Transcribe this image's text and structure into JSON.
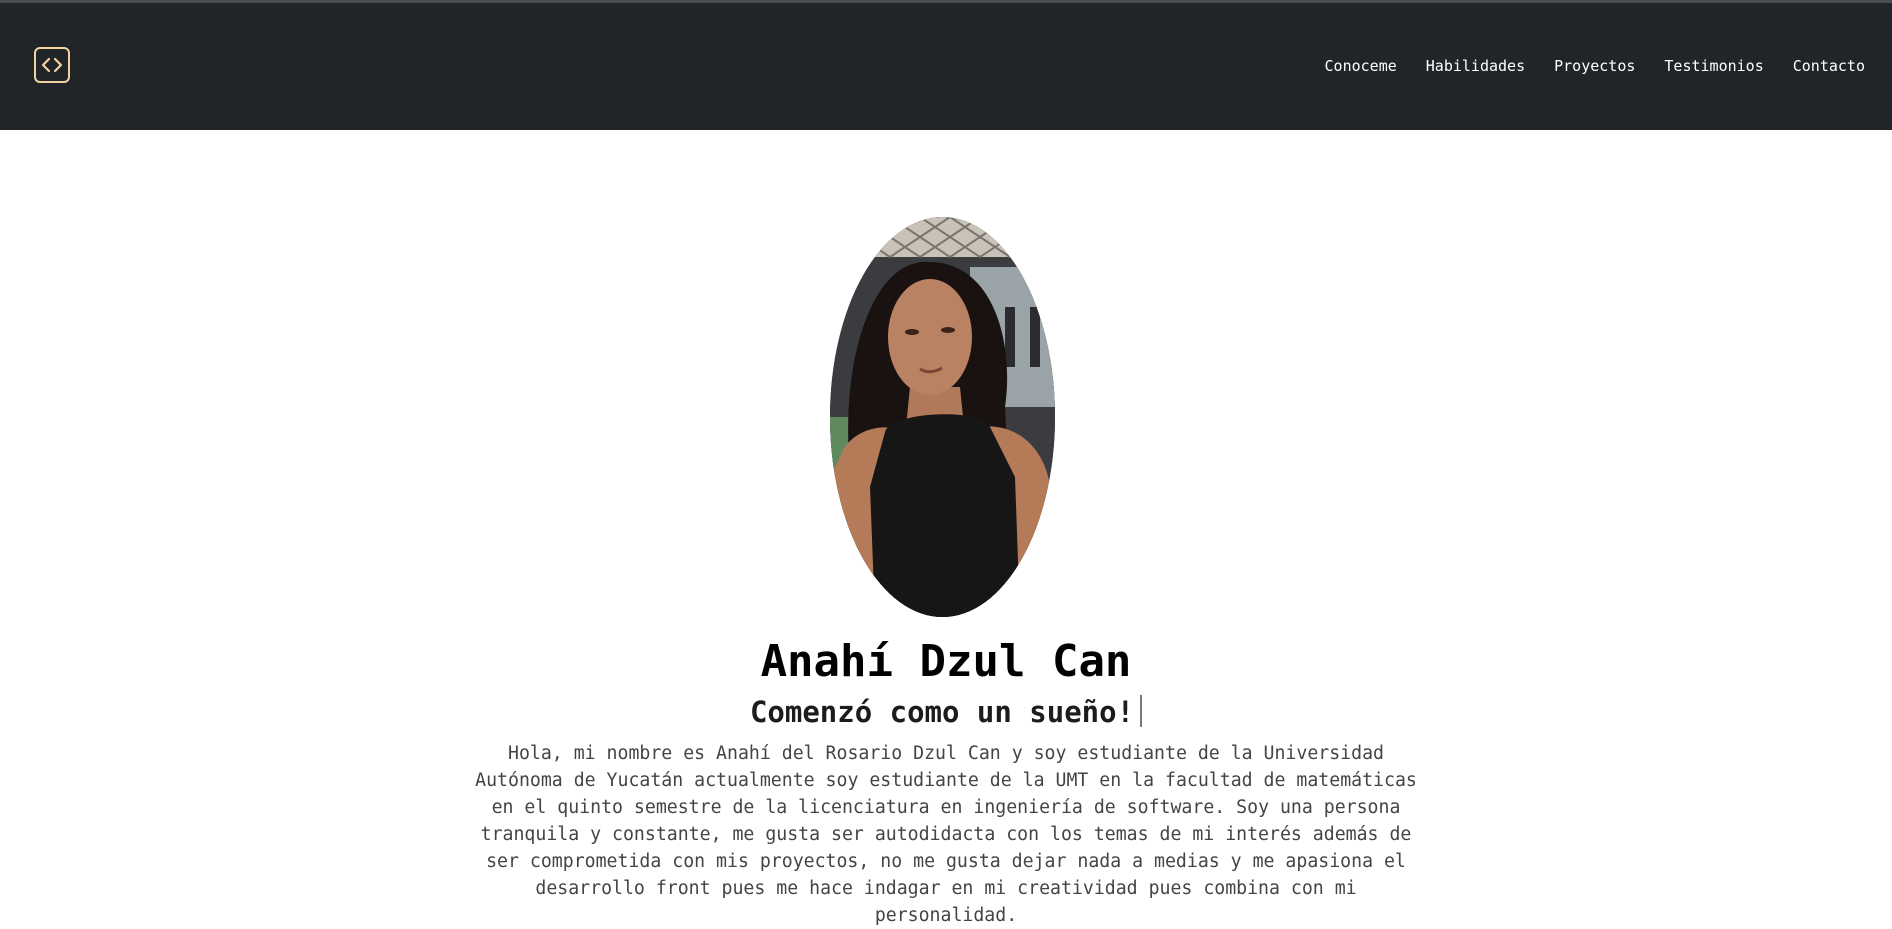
{
  "header": {
    "logo_icon": "code-brackets-icon",
    "logo_color": "#f3d3a1",
    "background": "#212529",
    "nav": [
      {
        "label": "Conoceme"
      },
      {
        "label": "Habilidades"
      },
      {
        "label": "Proyectos"
      },
      {
        "label": "Testimonios"
      },
      {
        "label": "Contacto"
      }
    ]
  },
  "hero": {
    "photo_alt": "profile-photo",
    "name": "Anahí Dzul Can",
    "tagline": "Comenzó como un sueño!",
    "bio": "Hola, mi nombre es Anahí del Rosario Dzul Can y soy estudiante de la Universidad Autónoma de Yucatán actualmente soy estudiante de la UMT en la facultad de matemáticas en el quinto semestre de la licenciatura en ingeniería de software. Soy una persona tranquila y constante, me gusta ser autodidacta con los temas de mi interés además de ser comprometida con mis proyectos, no me gusta dejar nada a medias y me apasiona el desarrollo front pues me hace indagar en mi creatividad pues combina con mi personalidad."
  }
}
